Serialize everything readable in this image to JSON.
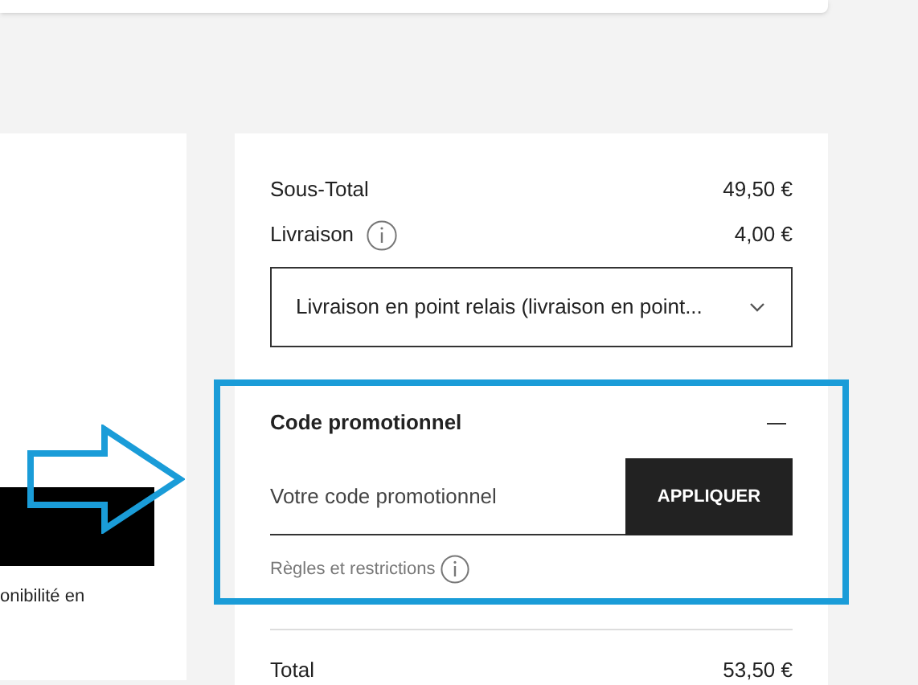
{
  "left_panel": {
    "note": "onibilité en"
  },
  "summary": {
    "subtotal": {
      "label": "Sous-Total",
      "value": "49,50 €"
    },
    "shipping": {
      "label": "Livraison",
      "value": "4,00 €"
    },
    "shipping_select": {
      "value": "Livraison en point relais (livraison en point..."
    },
    "promo": {
      "title": "Code promotionnel",
      "expanded": true,
      "placeholder": "Votre code promotionnel",
      "button": "APPLIQUER",
      "rules": "Règles et restrictions"
    },
    "total": {
      "label": "Total",
      "value": "53,50 €"
    }
  },
  "annotation": {
    "frame": true,
    "arrow": true
  }
}
